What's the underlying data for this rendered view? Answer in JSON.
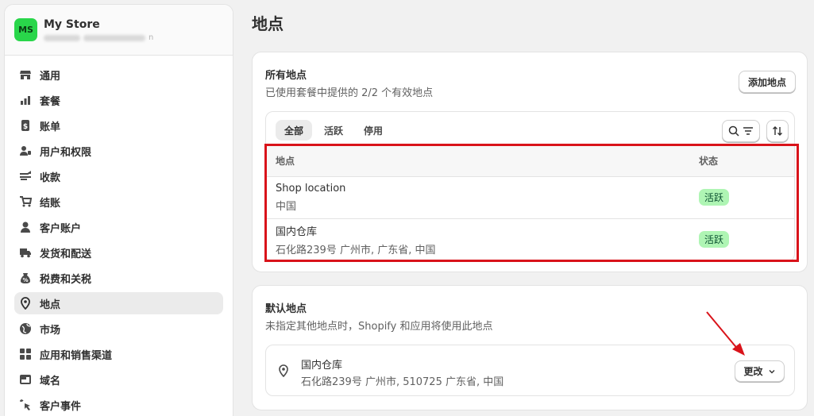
{
  "sidebar": {
    "store": {
      "initials": "MS",
      "name": "My Store",
      "subtitle_tail": "n"
    },
    "items": [
      {
        "label": "通用",
        "icon": "store-icon"
      },
      {
        "label": "套餐",
        "icon": "chart-icon"
      },
      {
        "label": "账单",
        "icon": "bill-icon"
      },
      {
        "label": "用户和权限",
        "icon": "users-icon"
      },
      {
        "label": "收款",
        "icon": "payments-icon"
      },
      {
        "label": "结账",
        "icon": "cart-icon"
      },
      {
        "label": "客户账户",
        "icon": "person-icon"
      },
      {
        "label": "发货和配送",
        "icon": "truck-icon"
      },
      {
        "label": "税费和关税",
        "icon": "tax-icon"
      },
      {
        "label": "地点",
        "icon": "location-icon",
        "active": true
      },
      {
        "label": "市场",
        "icon": "globe-icon"
      },
      {
        "label": "应用和销售渠道",
        "icon": "apps-icon"
      },
      {
        "label": "域名",
        "icon": "domain-icon"
      },
      {
        "label": "客户事件",
        "icon": "pointer-icon"
      }
    ]
  },
  "page": {
    "title": "地点"
  },
  "all_locations": {
    "title": "所有地点",
    "subtitle": "已使用套餐中提供的 2/2 个有效地点",
    "add_button": "添加地点",
    "tabs": [
      "全部",
      "活跃",
      "停用"
    ],
    "columns": [
      "地点",
      "状态"
    ],
    "rows": [
      {
        "name": "Shop location",
        "address": "中国",
        "status": "活跃"
      },
      {
        "name": "国内仓库",
        "address": "石化路239号 广州市, 广东省, 中国",
        "status": "活跃"
      }
    ]
  },
  "default_location": {
    "title": "默认地点",
    "subtitle": "未指定其他地点时，Shopify 和应用将使用此地点",
    "name": "国内仓库",
    "address": "石化路239号 广州市, 510725 广东省, 中国",
    "change_button": "更改"
  },
  "colors": {
    "accent_badge": "#aff5b4",
    "highlight": "#d9131a",
    "avatar": "#29d64a"
  }
}
